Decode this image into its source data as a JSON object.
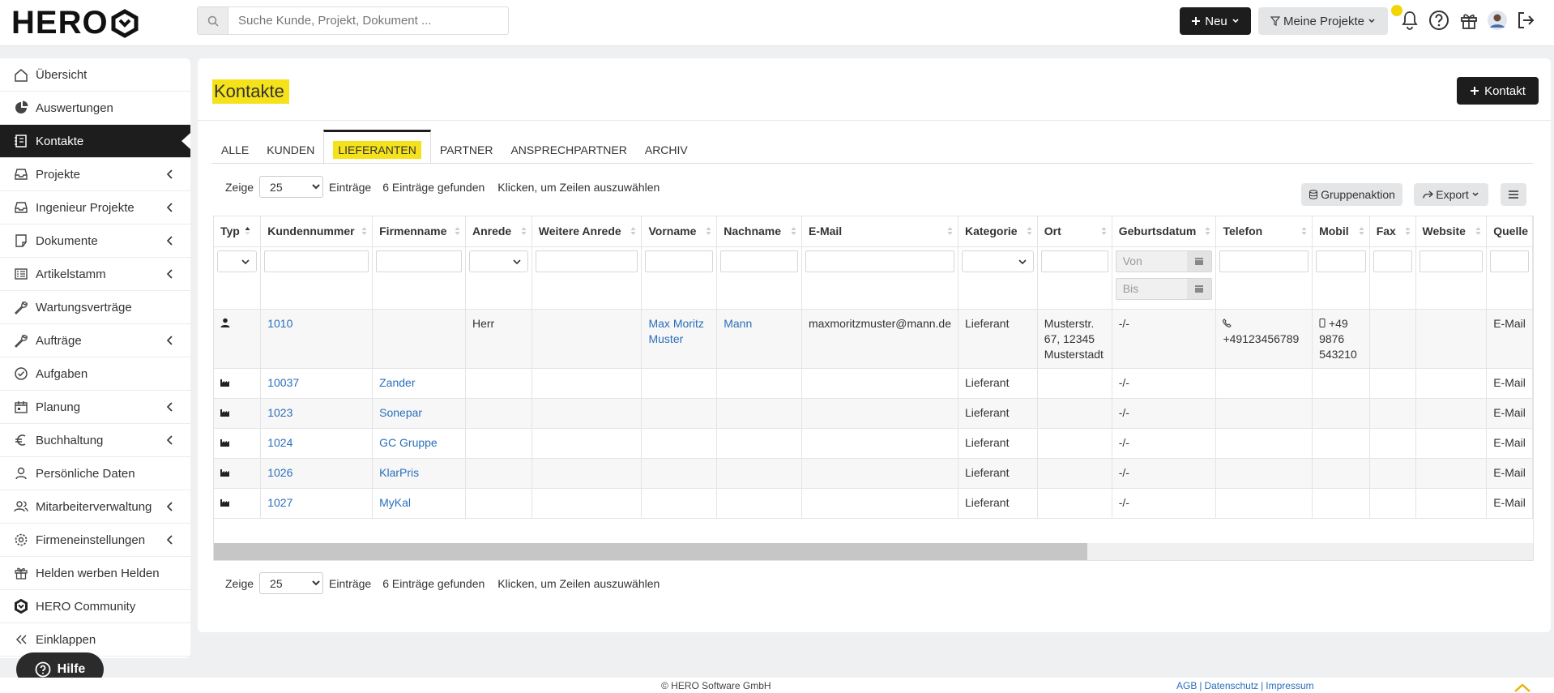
{
  "app": {
    "logo_text": "HERO",
    "search_placeholder": "Suche Kunde, Projekt, Dokument ...",
    "new_button": "Neu",
    "projects_filter": "Meine Projekte"
  },
  "sidebar": {
    "items": [
      {
        "label": "Übersicht",
        "icon": "home-icon",
        "submenu": false
      },
      {
        "label": "Auswertungen",
        "icon": "pie-chart-icon",
        "submenu": false
      },
      {
        "label": "Kontakte",
        "icon": "address-book-icon",
        "submenu": false,
        "active": true
      },
      {
        "label": "Projekte",
        "icon": "inbox-icon",
        "submenu": true
      },
      {
        "label": "Ingenieur Projekte",
        "icon": "inbox-icon",
        "submenu": true
      },
      {
        "label": "Dokumente",
        "icon": "note-icon",
        "submenu": true
      },
      {
        "label": "Artikelstamm",
        "icon": "list-icon",
        "submenu": true
      },
      {
        "label": "Wartungsverträge",
        "icon": "wrench-icon",
        "submenu": false
      },
      {
        "label": "Aufträge",
        "icon": "wrench-icon",
        "submenu": true
      },
      {
        "label": "Aufgaben",
        "icon": "check-circle-icon",
        "submenu": false
      },
      {
        "label": "Planung",
        "icon": "calendar-icon",
        "submenu": true
      },
      {
        "label": "Buchhaltung",
        "icon": "euro-icon",
        "submenu": true
      },
      {
        "label": "Persönliche Daten",
        "icon": "user-icon",
        "submenu": false
      },
      {
        "label": "Mitarbeiterverwaltung",
        "icon": "users-icon",
        "submenu": true
      },
      {
        "label": "Firmeneinstellungen",
        "icon": "gear-icon",
        "submenu": true
      },
      {
        "label": "Helden werben Helden",
        "icon": "gift-icon",
        "submenu": false
      },
      {
        "label": "HERO Community",
        "icon": "hero-community-icon",
        "submenu": false
      },
      {
        "label": "Einklappen",
        "icon": "collapse-icon",
        "submenu": false
      }
    ],
    "help_button": "Hilfe"
  },
  "main": {
    "title": "Kontakte",
    "add_button": "Kontakt",
    "tabs": [
      "ALLE",
      "KUNDEN",
      "LIEFERANTEN",
      "PARTNER",
      "ANSPRECHPARTNER",
      "ARCHIV"
    ],
    "active_tab": "LIEFERANTEN",
    "controls": {
      "show_label": "Zeige",
      "page_size": "25",
      "entries_label": "Einträge",
      "found_text": "6 Einträge gefunden",
      "click_hint": "Klicken, um Zeilen auszuwählen"
    },
    "group_action": "Gruppenaktion",
    "export": "Export"
  },
  "table": {
    "columns": [
      "Typ",
      "Kundennummer",
      "Firmenname",
      "Anrede",
      "Weitere Anrede",
      "Vorname",
      "Nachname",
      "E-Mail",
      "Kategorie",
      "Ort",
      "Geburtsdatum",
      "Telefon",
      "Mobil",
      "Fax",
      "Website",
      "Quelle"
    ],
    "date_from": "Von",
    "date_to": "Bis",
    "rows": [
      {
        "typ": "person-icon",
        "nr": "1010",
        "firma": "",
        "anrede": "Herr",
        "weitere": "",
        "vorname": "Max Moritz Muster",
        "nachname": "Mann",
        "email": "maxmoritzmuster@mann.de",
        "kategorie": "Lieferant",
        "ort": "Musterstr. 67, 12345 Musterstadt",
        "geburt": "-/-",
        "telefon": "+49123456789",
        "mobil": "+49 9876 543210",
        "fax": "",
        "website": "",
        "quelle": "E-Mail"
      },
      {
        "typ": "factory-icon",
        "nr": "10037",
        "firma": "Zander",
        "anrede": "",
        "weitere": "",
        "vorname": "",
        "nachname": "",
        "email": "",
        "kategorie": "Lieferant",
        "ort": "",
        "geburt": "-/-",
        "telefon": "",
        "mobil": "",
        "fax": "",
        "website": "",
        "quelle": "E-Mail"
      },
      {
        "typ": "factory-icon",
        "nr": "1023",
        "firma": "Sonepar",
        "anrede": "",
        "weitere": "",
        "vorname": "",
        "nachname": "",
        "email": "",
        "kategorie": "Lieferant",
        "ort": "",
        "geburt": "-/-",
        "telefon": "",
        "mobil": "",
        "fax": "",
        "website": "",
        "quelle": "E-Mail"
      },
      {
        "typ": "factory-icon",
        "nr": "1024",
        "firma": "GC Gruppe",
        "anrede": "",
        "weitere": "",
        "vorname": "",
        "nachname": "",
        "email": "",
        "kategorie": "Lieferant",
        "ort": "",
        "geburt": "-/-",
        "telefon": "",
        "mobil": "",
        "fax": "",
        "website": "",
        "quelle": "E-Mail"
      },
      {
        "typ": "factory-icon",
        "nr": "1026",
        "firma": "KlarPris",
        "anrede": "",
        "weitere": "",
        "vorname": "",
        "nachname": "",
        "email": "",
        "kategorie": "Lieferant",
        "ort": "",
        "geburt": "-/-",
        "telefon": "",
        "mobil": "",
        "fax": "",
        "website": "",
        "quelle": "E-Mail"
      },
      {
        "typ": "factory-icon",
        "nr": "1027",
        "firma": "MyKal",
        "anrede": "",
        "weitere": "",
        "vorname": "",
        "nachname": "",
        "email": "",
        "kategorie": "Lieferant",
        "ort": "",
        "geburt": "-/-",
        "telefon": "",
        "mobil": "",
        "fax": "",
        "website": "",
        "quelle": "E-Mail"
      }
    ]
  },
  "footer": {
    "copyright": "© HERO Software GmbH",
    "links": [
      "AGB",
      "Datenschutz",
      "Impressum"
    ]
  },
  "colors": {
    "accent_yellow": "#f5e21a",
    "dark": "#1d1d1d",
    "link": "#2a6ebb"
  }
}
